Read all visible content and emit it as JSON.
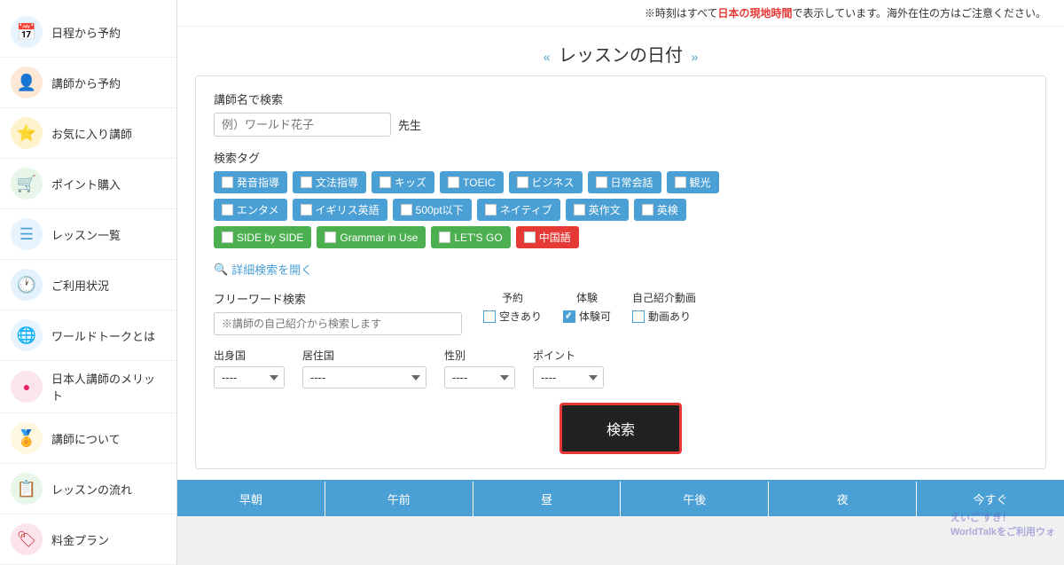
{
  "sidebar": {
    "items": [
      {
        "id": "schedule",
        "label": "日程から予約",
        "icon": "📅",
        "icon_class": "calendar"
      },
      {
        "id": "teacher",
        "label": "講師から予約",
        "icon": "👤",
        "icon_class": "teacher"
      },
      {
        "id": "favorites",
        "label": "お気に入り講師",
        "icon": "⭐",
        "icon_class": "star"
      },
      {
        "id": "points",
        "label": "ポイント購入",
        "icon": "🛒",
        "icon_class": "cart"
      },
      {
        "id": "lessons",
        "label": "レッスン一覧",
        "icon": "☰",
        "icon_class": "list"
      },
      {
        "id": "usage",
        "label": "ご利用状況",
        "icon": "🕐",
        "icon_class": "clock"
      },
      {
        "id": "about",
        "label": "ワールドトークとは",
        "icon": "🌐",
        "icon_class": "globe"
      },
      {
        "id": "merit",
        "label": "日本人講師のメリット",
        "icon": "●",
        "icon_class": "dot"
      },
      {
        "id": "instructor",
        "label": "講師について",
        "icon": "🏅",
        "icon_class": "award"
      },
      {
        "id": "flow",
        "label": "レッスンの流れ",
        "icon": "📋",
        "icon_class": "flow"
      },
      {
        "id": "plan",
        "label": "料金プラン",
        "icon": "🏷",
        "icon_class": "plan"
      }
    ]
  },
  "notice": {
    "text1": "※時刻はすべて",
    "text2": "日本の現地時間",
    "text3": "で表示しています。海外在住の方はご注意ください。"
  },
  "page_title": "レッスンの日付",
  "page_title_left_arrow": "«",
  "page_title_right_arrow": "»",
  "search_section": {
    "teacher_search_label": "講師名で検索",
    "teacher_input_placeholder": "例）ワールド花子",
    "teacher_suffix": "先生",
    "tag_section_label": "検索タグ",
    "tags_row1": [
      {
        "id": "hatsuon",
        "label": "発音指導"
      },
      {
        "id": "bunpou",
        "label": "文法指導"
      },
      {
        "id": "kids",
        "label": "キッズ"
      },
      {
        "id": "toeic",
        "label": "TOEIC"
      },
      {
        "id": "business",
        "label": "ビジネス"
      },
      {
        "id": "nichijou",
        "label": "日常会話"
      },
      {
        "id": "kanko",
        "label": "観光"
      }
    ],
    "tags_row2": [
      {
        "id": "entame",
        "label": "エンタメ"
      },
      {
        "id": "igirisu",
        "label": "イギリス英語"
      },
      {
        "id": "500pt",
        "label": "500pt以下"
      },
      {
        "id": "native",
        "label": "ネイティブ"
      },
      {
        "id": "esakubun",
        "label": "英作文"
      },
      {
        "id": "eiken",
        "label": "英検"
      }
    ],
    "tags_row3": [
      {
        "id": "sidebyside",
        "label": "SIDE by SIDE",
        "style": "green"
      },
      {
        "id": "grammar",
        "label": "Grammar in Use",
        "style": "green"
      },
      {
        "id": "letsgo",
        "label": "LET'S GO",
        "style": "green"
      },
      {
        "id": "chinese",
        "label": "中国語",
        "style": "red"
      }
    ],
    "detail_search_label": "詳細検索を開く",
    "freeword_label": "フリーワード検索",
    "freeword_placeholder": "※講師の自己紹介から検索します",
    "filters": [
      {
        "id": "yoyaku",
        "label": "予約",
        "checkbox_label": "空きあり",
        "checked": false
      },
      {
        "id": "taiken",
        "label": "体験",
        "checkbox_label": "体験可",
        "checked": true
      },
      {
        "id": "jiko",
        "label": "自己紹介動画",
        "checkbox_label": "動画あり",
        "checked": false
      }
    ],
    "dropdowns": [
      {
        "id": "birthcountry",
        "label": "出身国",
        "value": "----",
        "options": [
          "----"
        ]
      },
      {
        "id": "residencecountry",
        "label": "居住国",
        "value": "----",
        "options": [
          "----"
        ]
      },
      {
        "id": "gender",
        "label": "性別",
        "value": "----",
        "options": [
          "----"
        ]
      },
      {
        "id": "points",
        "label": "ポイント",
        "value": "----",
        "options": [
          "----"
        ]
      }
    ],
    "search_button_label": "検索"
  },
  "time_tabs": [
    {
      "id": "early",
      "label": "早朝"
    },
    {
      "id": "morning",
      "label": "午前"
    },
    {
      "id": "noon",
      "label": "昼"
    },
    {
      "id": "afternoon",
      "label": "午後"
    },
    {
      "id": "night",
      "label": "夜"
    },
    {
      "id": "now",
      "label": "今すぐ"
    }
  ]
}
